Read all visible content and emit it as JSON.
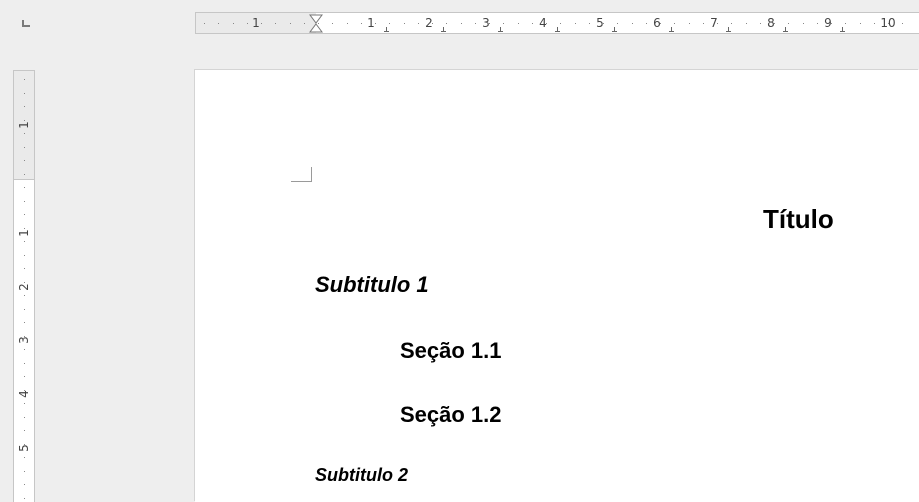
{
  "h_ruler": {
    "labels": [
      "1",
      "1",
      "2",
      "3",
      "4",
      "5",
      "6",
      "7",
      "8",
      "9",
      "10"
    ]
  },
  "v_ruler": {
    "labels": [
      "1",
      "1",
      "2",
      "3",
      "4",
      "5"
    ]
  },
  "document": {
    "title": "Título",
    "subtitle_1": "Subtitulo 1",
    "section_1_1": "Seção 1.1",
    "section_1_2": "Seção 1.2",
    "subtitle_2": "Subtitulo 2"
  }
}
